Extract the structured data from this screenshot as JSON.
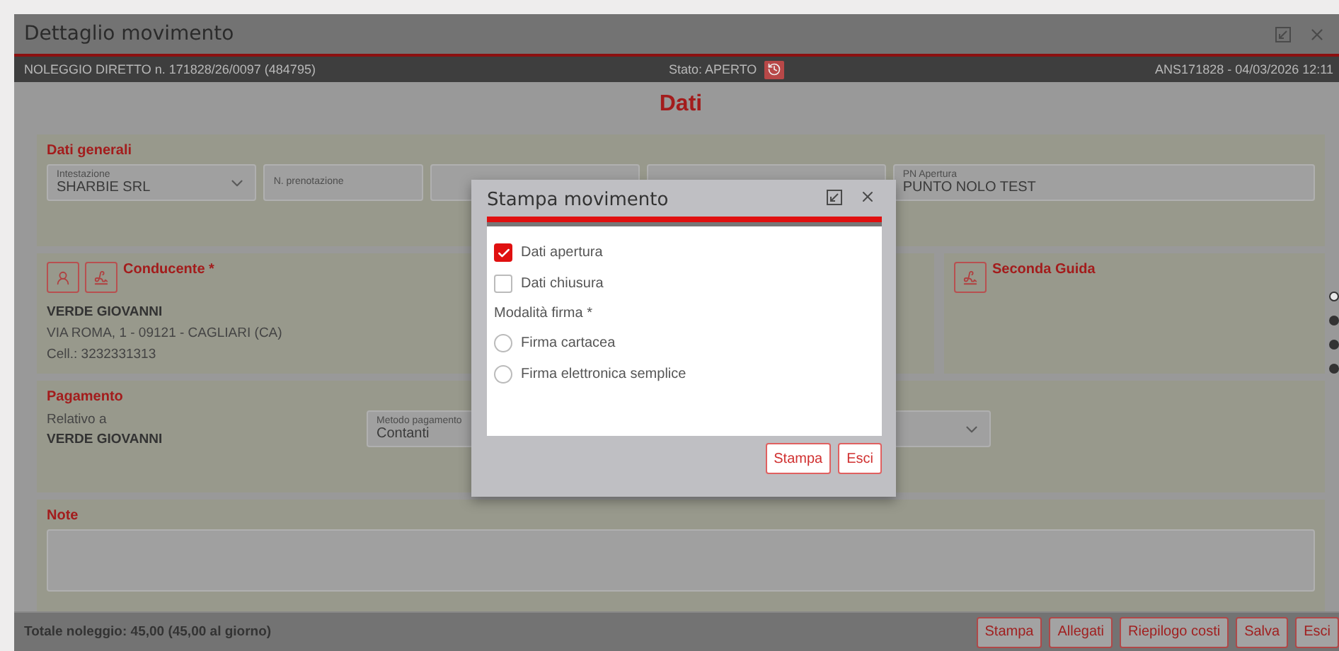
{
  "window": {
    "title": "Dettaglio movimento"
  },
  "header_bar": {
    "booking": "NOLEGGIO DIRETTO n. 171828/26/0097 (484795)",
    "status": "Stato: APERTO",
    "reference": "ANS171828 - 04/03/2026 12:11"
  },
  "section_title": "Dati",
  "general": {
    "title": "Dati generali",
    "fields": [
      {
        "kind": "select",
        "label": "Intestazione",
        "value": "SHARBIE SRL"
      },
      {
        "kind": "text",
        "placeholder": "N. prenotazione"
      },
      {
        "kind": "blank"
      },
      {
        "kind": "blank"
      },
      {
        "kind": "text",
        "label": "PN Apertura",
        "value": "PUNTO NOLO TEST"
      }
    ]
  },
  "driver": {
    "title": "Conducente *",
    "name": "VERDE GIOVANNI",
    "address": "VIA ROMA, 1 - 09121 - CAGLIARI (CA)",
    "phone": "Cell.: 3232331313"
  },
  "second_driver": {
    "title": "Seconda Guida"
  },
  "pager": [
    {
      "selected": true
    },
    {
      "selected": false
    },
    {
      "selected": false
    },
    {
      "selected": false
    }
  ],
  "payment": {
    "title": "Pagamento",
    "relative_label": "Relativo a",
    "relative_value": "VERDE GIOVANNI",
    "method_label": "Metodo pagamento",
    "method_value": "Contanti"
  },
  "notes": {
    "title": "Note"
  },
  "footer": {
    "total": "Totale noleggio: 45,00 (45,00 al giorno)",
    "buttons": [
      "Stampa",
      "Allegati",
      "Riepilogo costi",
      "Salva",
      "Esci"
    ]
  },
  "dialog": {
    "title": "Stampa movimento",
    "options": [
      {
        "label": "Dati apertura",
        "checked": true
      },
      {
        "label": "Dati chiusura",
        "checked": false
      }
    ],
    "signature": {
      "label": "Modalità firma *",
      "options": [
        {
          "label": "Firma cartacea",
          "selected": false
        },
        {
          "label": "Firma elettronica semplice",
          "selected": false
        }
      ]
    },
    "buttons": [
      "Stampa",
      "Esci"
    ]
  }
}
